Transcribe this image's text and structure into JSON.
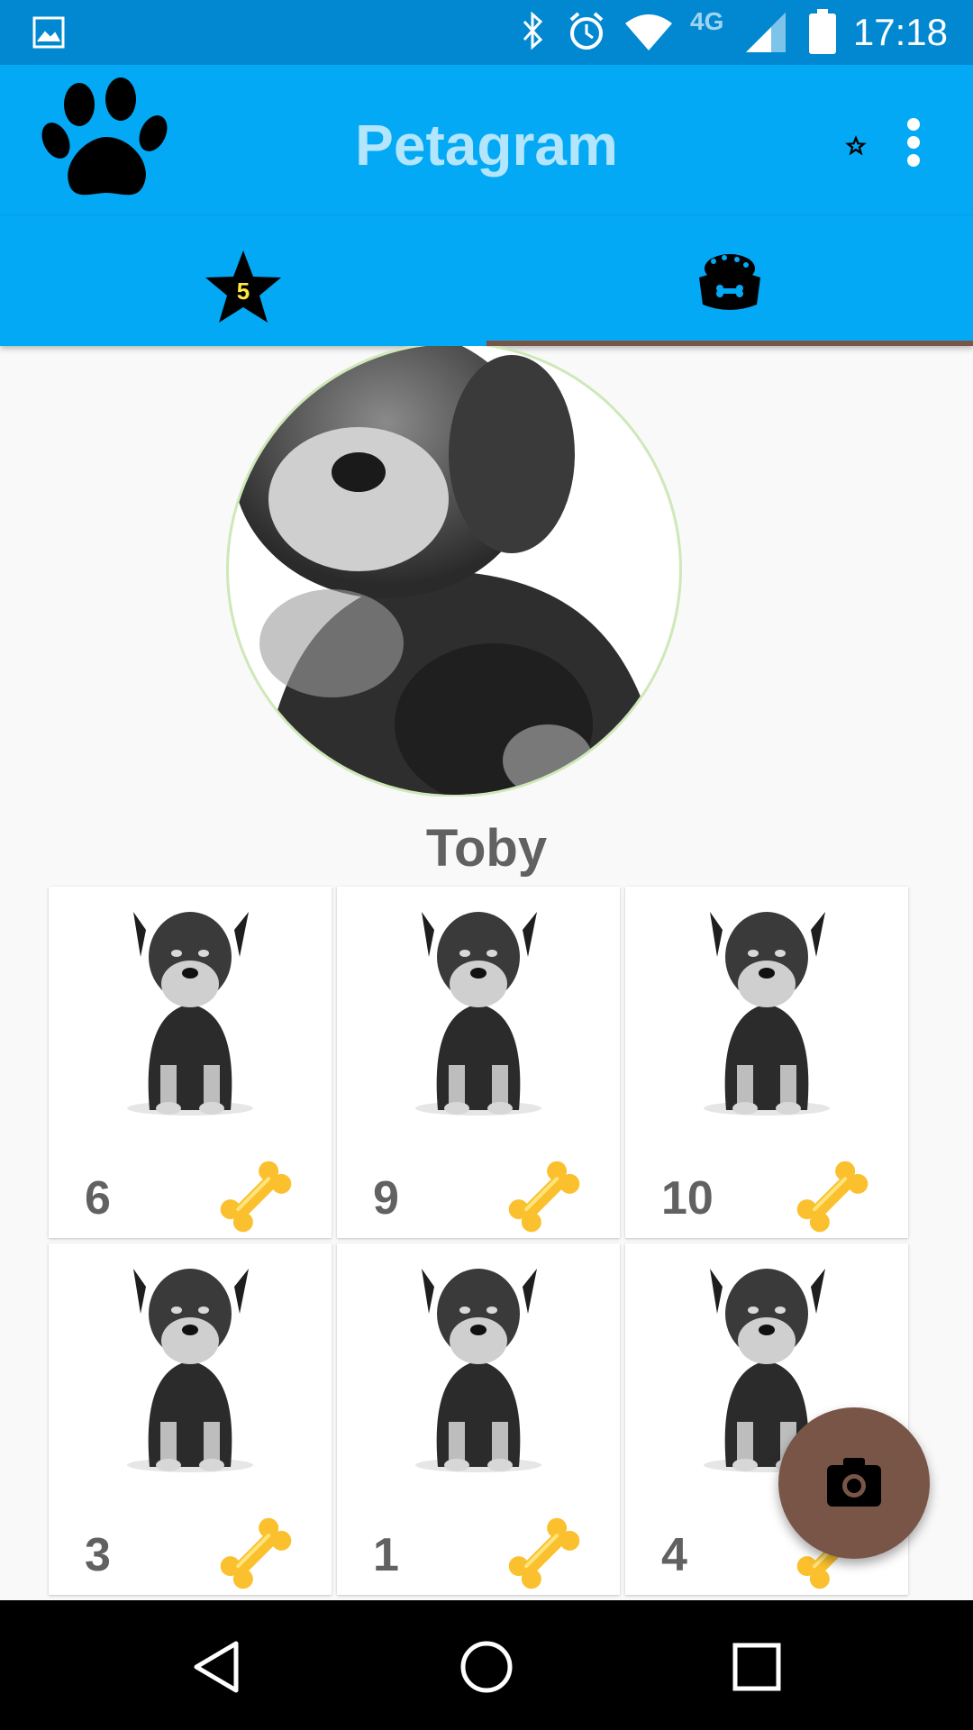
{
  "status_bar": {
    "time": "17:18",
    "network": "4G",
    "icons": [
      "gallery-notification-icon",
      "bluetooth-icon",
      "alarm-icon",
      "wifi-icon",
      "signal-icon",
      "battery-icon"
    ]
  },
  "app_bar": {
    "title": "Petagram",
    "logo_icon": "paw-icon",
    "actions": [
      "favorites-star-icon",
      "overflow-menu-icon"
    ]
  },
  "tabs": [
    {
      "name": "favorites",
      "icon": "star-badge-icon",
      "badge": "5",
      "selected": false
    },
    {
      "name": "profile",
      "icon": "pet-bowl-icon",
      "selected": true
    }
  ],
  "profile": {
    "name": "Toby",
    "photos": [
      {
        "likes": "6"
      },
      {
        "likes": "9"
      },
      {
        "likes": "10"
      },
      {
        "likes": "3"
      },
      {
        "likes": "1"
      },
      {
        "likes": "4"
      }
    ]
  },
  "fab": {
    "icon": "camera-icon"
  },
  "nav_bar": {
    "buttons": [
      "back-icon",
      "home-icon",
      "recents-icon"
    ]
  },
  "colors": {
    "primary": "#03a9f4",
    "primary_dark": "#0288d1",
    "accent": "#795548",
    "title_text": "#b3e5fc",
    "bone": "#fbc02d"
  }
}
